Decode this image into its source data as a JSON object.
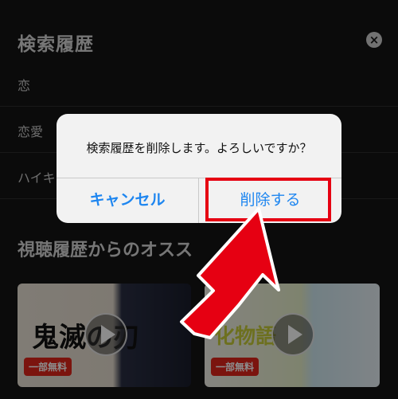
{
  "history": {
    "title": "検索履歴",
    "clear_icon": "close-icon",
    "items": [
      "恋",
      "恋愛",
      "ハイキ"
    ]
  },
  "recommend": {
    "title": "視聴履歴からのオスス",
    "cards": [
      {
        "title": "鬼滅の刃",
        "badge": "一部無料"
      },
      {
        "title": "化物語",
        "badge": "一部無料"
      }
    ]
  },
  "dialog": {
    "message": "検索履歴を削除します。よろしいですか？",
    "cancel_label": "キャンセル",
    "delete_label": "削除する"
  },
  "colors": {
    "accent_blue": "#1e86f0",
    "highlight_red": "#e60012",
    "badge_red": "#e1251b"
  }
}
